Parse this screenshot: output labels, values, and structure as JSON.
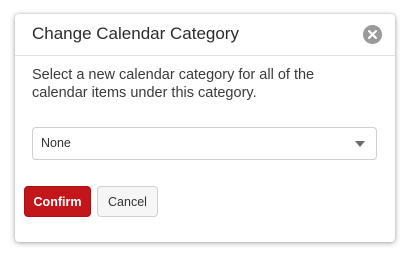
{
  "dialog": {
    "title": "Change Calendar Category",
    "close_icon": "close-icon",
    "message": "Select a new calendar category for all of the calendar items under this category.",
    "category_select": {
      "selected_value": "None",
      "caret_icon": "chevron-down-icon"
    },
    "buttons": {
      "confirm_label": "Confirm",
      "cancel_label": "Cancel"
    }
  },
  "colors": {
    "confirm_background": "#c2161b",
    "close_icon_background": "#9a9a9a"
  }
}
